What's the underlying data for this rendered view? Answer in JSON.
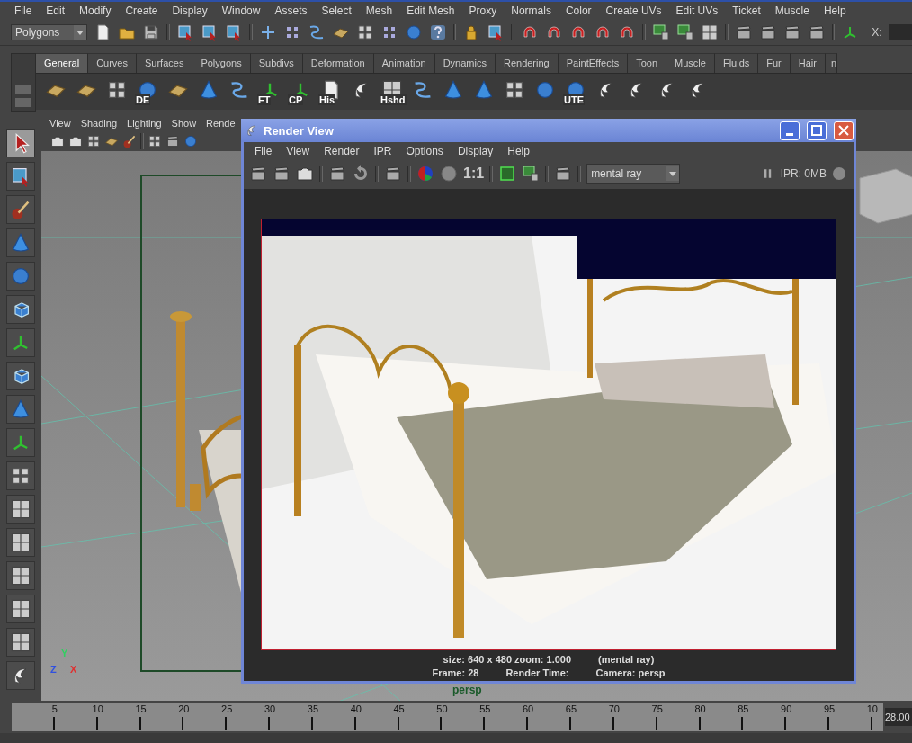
{
  "menu_bar": [
    "File",
    "Edit",
    "Modify",
    "Create",
    "Display",
    "Window",
    "Assets",
    "Select",
    "Mesh",
    "Edit Mesh",
    "Proxy",
    "Normals",
    "Color",
    "Create UVs",
    "Edit UVs",
    "Ticket",
    "Muscle",
    "Help"
  ],
  "status_line": {
    "mode": "Polygons",
    "coord_label": "X:"
  },
  "shelf_tabs": [
    {
      "label": "General",
      "selected": true
    },
    {
      "label": "Curves",
      "selected": false
    },
    {
      "label": "Surfaces",
      "selected": false
    },
    {
      "label": "Polygons",
      "selected": false
    },
    {
      "label": "Subdivs",
      "selected": false
    },
    {
      "label": "Deformation",
      "selected": false
    },
    {
      "label": "Animation",
      "selected": false
    },
    {
      "label": "Dynamics",
      "selected": false
    },
    {
      "label": "Rendering",
      "selected": false
    },
    {
      "label": "PaintEffects",
      "selected": false
    },
    {
      "label": "Toon",
      "selected": false
    },
    {
      "label": "Muscle",
      "selected": false
    },
    {
      "label": "Fluids",
      "selected": false
    },
    {
      "label": "Fur",
      "selected": false
    },
    {
      "label": "Hair",
      "selected": false
    },
    {
      "label": "n",
      "selected": false
    }
  ],
  "shelf_items": [
    {
      "kind": "icon"
    },
    {
      "kind": "icon"
    },
    {
      "kind": "icon"
    },
    {
      "kind": "labeled",
      "label": "DE"
    },
    {
      "kind": "icon"
    },
    {
      "kind": "icon"
    },
    {
      "kind": "icon"
    },
    {
      "kind": "labeled",
      "label": "FT"
    },
    {
      "kind": "labeled",
      "label": "CP"
    },
    {
      "kind": "labeled",
      "label": "His"
    },
    {
      "kind": "icon"
    },
    {
      "kind": "labeled",
      "label": "Hshd"
    },
    {
      "kind": "icon"
    },
    {
      "kind": "icon"
    },
    {
      "kind": "icon"
    },
    {
      "kind": "icon"
    },
    {
      "kind": "icon"
    },
    {
      "kind": "labeled",
      "label": "UTE"
    },
    {
      "kind": "icon"
    },
    {
      "kind": "icon"
    },
    {
      "kind": "icon"
    },
    {
      "kind": "icon"
    }
  ],
  "toolbox": [
    {
      "selected": true
    },
    {
      "selected": false
    },
    {
      "selected": false
    },
    {
      "selected": false
    },
    {
      "selected": false
    },
    {
      "selected": false
    },
    {
      "selected": false
    },
    {
      "selected": false
    },
    {
      "selected": false
    },
    {
      "selected": false
    },
    {
      "selected": false
    },
    {
      "selected": false
    },
    {
      "selected": false
    },
    {
      "selected": false
    },
    {
      "selected": false
    },
    {
      "selected": false
    },
    {
      "selected": false
    }
  ],
  "panel_menu": [
    "View",
    "Shading",
    "Lighting",
    "Show",
    "Rende"
  ],
  "viewport": {
    "axes": [
      "Y",
      "Z",
      "X"
    ],
    "camera": "persp"
  },
  "render_view": {
    "title": "Render View",
    "menu": [
      "File",
      "View",
      "Render",
      "IPR",
      "Options",
      "Display",
      "Help"
    ],
    "ratio": "1:1",
    "renderer": "mental ray",
    "ipr": "IPR: 0MB",
    "size_info": "size: 640 x 480 zoom: 1.000",
    "renderer_info": "(mental ray)",
    "frame": "Frame: 28",
    "render_time": "Render Time:",
    "camera": "Camera: persp"
  },
  "time_slider": {
    "ticks": [
      "5",
      "10",
      "15",
      "20",
      "25",
      "30",
      "35",
      "40",
      "45",
      "50",
      "55",
      "60",
      "65",
      "70",
      "75",
      "80",
      "85",
      "90",
      "95",
      "10"
    ],
    "current": "28.00"
  }
}
